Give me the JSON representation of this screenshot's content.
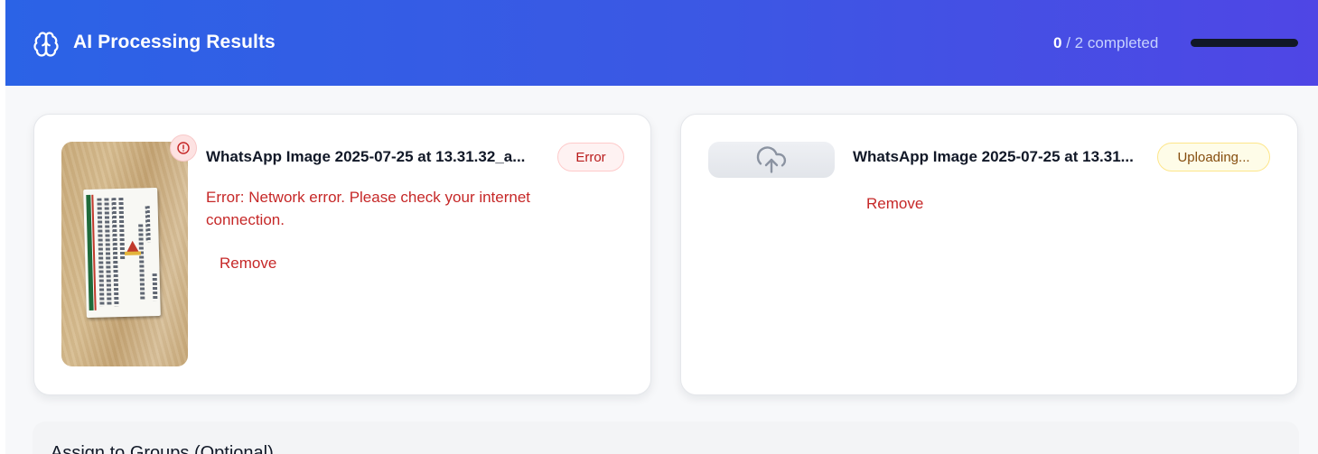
{
  "header": {
    "title": "AI Processing Results",
    "icon": "brain-icon",
    "progress": {
      "completed": "0",
      "separator": "/",
      "total": "2",
      "suffix": "completed",
      "fraction": 0
    }
  },
  "files": [
    {
      "filename": "WhatsApp Image 2025-07-25 at 13.31.32_a...",
      "status": "Error",
      "error_message": "Error: Network error. Please check your internet connection.",
      "remove_label": "Remove",
      "thumbnail": "business-card-photo"
    },
    {
      "filename": "WhatsApp Image 2025-07-25 at 13.31...",
      "status": "Uploading...",
      "remove_label": "Remove",
      "thumbnail": "cloud-upload-icon"
    }
  ],
  "groups": {
    "title": "Assign to Groups (Optional)"
  },
  "colors": {
    "header_start": "#2b63e6",
    "header_end": "#4f46e5",
    "error": "#c62828",
    "uploading_text": "#854d0e"
  }
}
